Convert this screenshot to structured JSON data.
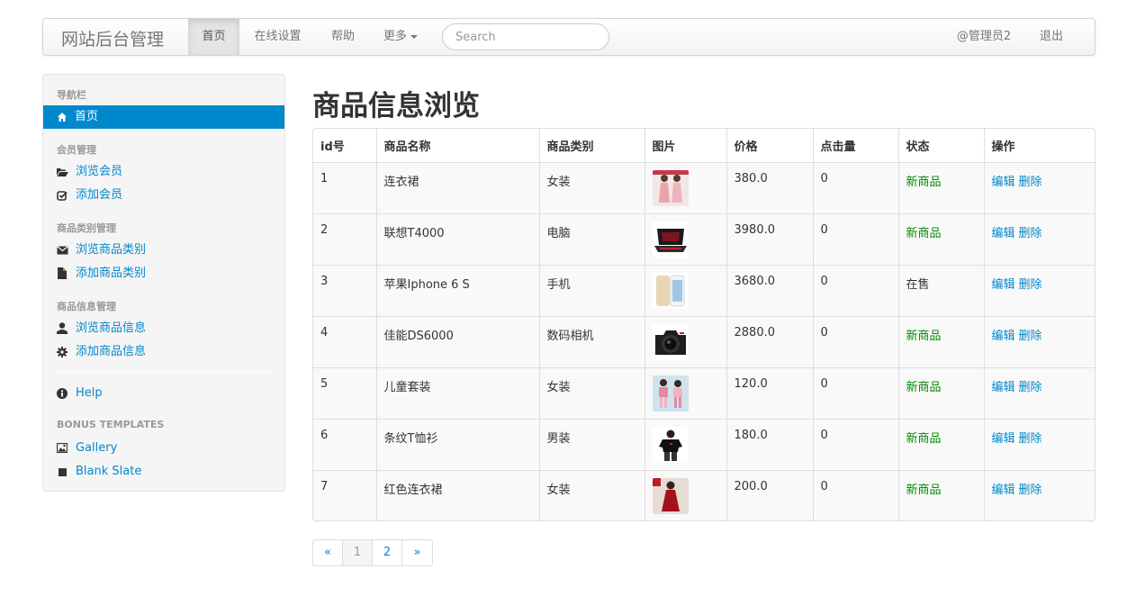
{
  "navbar": {
    "brand": "网站后台管理",
    "items": [
      {
        "label": "首页"
      },
      {
        "label": "在线设置"
      },
      {
        "label": "帮助"
      },
      {
        "label": "更多"
      }
    ],
    "search_placeholder": "Search",
    "user": "@管理员2",
    "logout": "退出"
  },
  "sidebar": {
    "nav_header": "导航栏",
    "home": {
      "label": "首页",
      "icon": "home-icon"
    },
    "groups": [
      {
        "header": "会员管理",
        "links": [
          {
            "label": "浏览会员",
            "icon": "folder-open-icon"
          },
          {
            "label": "添加会员",
            "icon": "check-square-icon"
          }
        ]
      },
      {
        "header": "商品类别管理",
        "links": [
          {
            "label": "浏览商品类别",
            "icon": "envelope-icon"
          },
          {
            "label": "添加商品类别",
            "icon": "file-icon"
          }
        ]
      },
      {
        "header": "商品信息管理",
        "links": [
          {
            "label": "浏览商品信息",
            "icon": "user-icon"
          },
          {
            "label": "添加商品信息",
            "icon": "cog-icon"
          }
        ]
      }
    ],
    "help": {
      "label": "Help",
      "icon": "info-icon"
    },
    "bonus_header": "BONUS TEMPLATES",
    "bonus_links": [
      {
        "label": "Gallery",
        "icon": "picture-icon"
      },
      {
        "label": "Blank Slate",
        "icon": "stop-icon"
      }
    ]
  },
  "main": {
    "title": "商品信息浏览",
    "columns": [
      "id号",
      "商品名称",
      "商品类别",
      "图片",
      "价格",
      "点击量",
      "状态",
      "操作"
    ],
    "rows": [
      {
        "id": "1",
        "name": "连衣裙",
        "category": "女装",
        "image": "pink-dress-photo",
        "price": "380.0",
        "clicks": "0",
        "status": "新商品",
        "status_new": true
      },
      {
        "id": "2",
        "name": "联想T4000",
        "category": "电脑",
        "image": "laptop-photo",
        "price": "3980.0",
        "clicks": "0",
        "status": "新商品",
        "status_new": true
      },
      {
        "id": "3",
        "name": "苹果Iphone 6 S",
        "category": "手机",
        "image": "iphone-photo",
        "price": "3680.0",
        "clicks": "0",
        "status": "在售",
        "status_new": false
      },
      {
        "id": "4",
        "name": "佳能DS6000",
        "category": "数码相机",
        "image": "camera-photo",
        "price": "2880.0",
        "clicks": "0",
        "status": "新商品",
        "status_new": true
      },
      {
        "id": "5",
        "name": "儿童套装",
        "category": "女装",
        "image": "kids-outfit-photo",
        "price": "120.0",
        "clicks": "0",
        "status": "新商品",
        "status_new": true
      },
      {
        "id": "6",
        "name": "条纹T恤衫",
        "category": "男装",
        "image": "black-tshirt-photo",
        "price": "180.0",
        "clicks": "0",
        "status": "新商品",
        "status_new": true
      },
      {
        "id": "7",
        "name": "红色连衣裙",
        "category": "女装",
        "image": "red-dress-photo",
        "price": "200.0",
        "clicks": "0",
        "status": "新商品",
        "status_new": true
      }
    ],
    "actions": {
      "edit": "编辑",
      "delete": "删除"
    },
    "pagination": [
      "«",
      "1",
      "2",
      "»"
    ],
    "current_page": "1"
  },
  "colors": {
    "link": "#0088cc",
    "status_new": "#008a00",
    "sidebar_active": "#0088cc"
  }
}
